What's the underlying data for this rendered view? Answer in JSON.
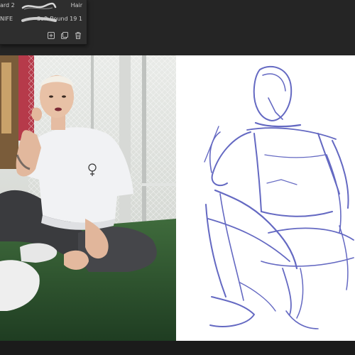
{
  "brush_panel": {
    "rows": [
      {
        "left_label": "ard 2",
        "right_label": "Hair"
      },
      {
        "left_label": "NIFE",
        "right_label": "Soft Round 19 1"
      }
    ],
    "toolbar_icons": [
      "add-brush-icon",
      "duplicate-brush-icon",
      "delete-brush-icon"
    ]
  },
  "reference_photo": {
    "description_icon": "reference-image"
  },
  "canvas": {
    "stroke_color": "#4a4fb8"
  },
  "colors": {
    "app_background": "#1e1e1e",
    "panel_background": "#2e2e2e",
    "canvas_background": "#ffffff",
    "sketch_stroke": "#4a4fb8"
  }
}
